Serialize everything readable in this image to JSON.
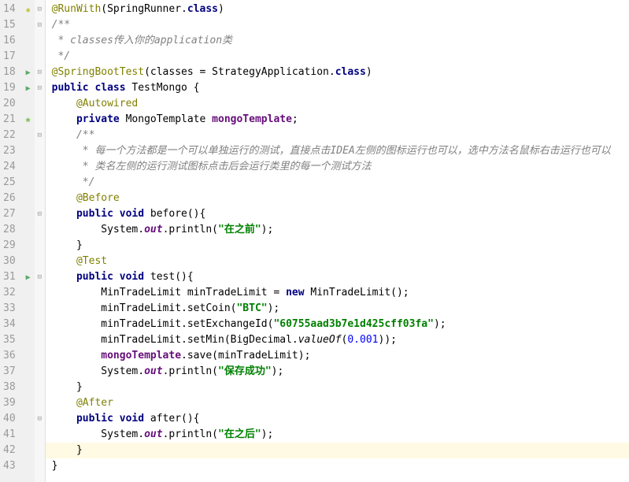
{
  "lines": [
    {
      "num": "14",
      "icon": "dot",
      "fold": "open",
      "ind": 0,
      "tokens": [
        {
          "t": "ann",
          "v": "@RunWith"
        },
        {
          "t": "",
          "v": "(SpringRunner."
        },
        {
          "t": "kw",
          "v": "class"
        },
        {
          "t": "",
          "v": ")"
        }
      ]
    },
    {
      "num": "15",
      "icon": "",
      "fold": "open",
      "ind": 0,
      "tokens": [
        {
          "t": "cmt",
          "v": "/**"
        }
      ],
      "bg": "cmt"
    },
    {
      "num": "16",
      "icon": "",
      "fold": "",
      "ind": 0,
      "tokens": [
        {
          "t": "cmt",
          "v": " * classes传入你的application类"
        }
      ]
    },
    {
      "num": "17",
      "icon": "",
      "fold": "",
      "ind": 0,
      "tokens": [
        {
          "t": "cmt",
          "v": " */"
        }
      ]
    },
    {
      "num": "18",
      "icon": "run",
      "fold": "open",
      "ind": 0,
      "tokens": [
        {
          "t": "ann",
          "v": "@SpringBootTest"
        },
        {
          "t": "",
          "v": "(classes = StrategyApplication."
        },
        {
          "t": "kw",
          "v": "class"
        },
        {
          "t": "",
          "v": ")"
        }
      ]
    },
    {
      "num": "19",
      "icon": "run",
      "fold": "open",
      "ind": 0,
      "tokens": [
        {
          "t": "kw",
          "v": "public class "
        },
        {
          "t": "cls",
          "v": "TestMongo {"
        }
      ]
    },
    {
      "num": "20",
      "icon": "",
      "fold": "",
      "ind": 1,
      "tokens": [
        {
          "t": "ann",
          "v": "@Autowired"
        }
      ]
    },
    {
      "num": "21",
      "icon": "spring",
      "fold": "",
      "ind": 1,
      "tokens": [
        {
          "t": "kw",
          "v": "private "
        },
        {
          "t": "",
          "v": "MongoTemplate "
        },
        {
          "t": "fld",
          "v": "mongoTemplate"
        },
        {
          "t": "",
          "v": ";"
        }
      ]
    },
    {
      "num": "22",
      "icon": "",
      "fold": "open",
      "ind": 1,
      "tokens": [
        {
          "t": "cmt",
          "v": "/**"
        }
      ]
    },
    {
      "num": "23",
      "icon": "",
      "fold": "",
      "ind": 1,
      "tokens": [
        {
          "t": "cmt",
          "v": " * 每一个方法都是一个可以单独运行的测试，直接点击IDEA左侧的图标运行也可以，选中方法名鼠标右击运行也可以"
        }
      ]
    },
    {
      "num": "24",
      "icon": "",
      "fold": "",
      "ind": 1,
      "tokens": [
        {
          "t": "cmt",
          "v": " * 类名左侧的运行测试图标点击后会运行类里的每一个测试方法"
        }
      ]
    },
    {
      "num": "25",
      "icon": "",
      "fold": "",
      "ind": 1,
      "tokens": [
        {
          "t": "cmt",
          "v": " */"
        }
      ]
    },
    {
      "num": "26",
      "icon": "",
      "fold": "",
      "ind": 1,
      "tokens": [
        {
          "t": "ann",
          "v": "@Before"
        }
      ]
    },
    {
      "num": "27",
      "icon": "",
      "fold": "open",
      "ind": 1,
      "tokens": [
        {
          "t": "kw",
          "v": "public void "
        },
        {
          "t": "",
          "v": "before(){"
        }
      ]
    },
    {
      "num": "28",
      "icon": "",
      "fold": "",
      "ind": 2,
      "tokens": [
        {
          "t": "",
          "v": "System."
        },
        {
          "t": "fld static",
          "v": "out"
        },
        {
          "t": "",
          "v": ".println("
        },
        {
          "t": "str",
          "v": "\"在之前\""
        },
        {
          "t": "",
          "v": ");"
        }
      ]
    },
    {
      "num": "29",
      "icon": "",
      "fold": "",
      "ind": 1,
      "tokens": [
        {
          "t": "",
          "v": "}"
        }
      ]
    },
    {
      "num": "30",
      "icon": "",
      "fold": "",
      "ind": 1,
      "tokens": [
        {
          "t": "ann",
          "v": "@Test"
        }
      ]
    },
    {
      "num": "31",
      "icon": "run",
      "fold": "open",
      "ind": 1,
      "tokens": [
        {
          "t": "kw",
          "v": "public void "
        },
        {
          "t": "",
          "v": "test(){"
        }
      ]
    },
    {
      "num": "32",
      "icon": "",
      "fold": "",
      "ind": 2,
      "tokens": [
        {
          "t": "",
          "v": "MinTradeLimit minTradeLimit = "
        },
        {
          "t": "kw",
          "v": "new "
        },
        {
          "t": "",
          "v": "MinTradeLimit();"
        }
      ]
    },
    {
      "num": "33",
      "icon": "",
      "fold": "",
      "ind": 2,
      "tokens": [
        {
          "t": "",
          "v": "minTradeLimit.setCoin("
        },
        {
          "t": "str",
          "v": "\"BTC\""
        },
        {
          "t": "",
          "v": ");"
        }
      ]
    },
    {
      "num": "34",
      "icon": "",
      "fold": "",
      "ind": 2,
      "tokens": [
        {
          "t": "",
          "v": "minTradeLimit.setExchangeId("
        },
        {
          "t": "str",
          "v": "\"60755aad3b7e1d425cff03fa\""
        },
        {
          "t": "",
          "v": ");"
        }
      ]
    },
    {
      "num": "35",
      "icon": "",
      "fold": "",
      "ind": 2,
      "tokens": [
        {
          "t": "",
          "v": "minTradeLimit.setMin(BigDecimal."
        },
        {
          "t": "static",
          "v": "valueOf"
        },
        {
          "t": "",
          "v": "("
        },
        {
          "t": "num",
          "v": "0.001"
        },
        {
          "t": "",
          "v": "));"
        }
      ]
    },
    {
      "num": "36",
      "icon": "",
      "fold": "",
      "ind": 2,
      "tokens": [
        {
          "t": "fld",
          "v": "mongoTemplate"
        },
        {
          "t": "",
          "v": ".save(minTradeLimit);"
        }
      ]
    },
    {
      "num": "37",
      "icon": "",
      "fold": "",
      "ind": 2,
      "tokens": [
        {
          "t": "",
          "v": "System."
        },
        {
          "t": "fld static",
          "v": "out"
        },
        {
          "t": "",
          "v": ".println("
        },
        {
          "t": "str",
          "v": "\"保存成功\""
        },
        {
          "t": "",
          "v": ");"
        }
      ]
    },
    {
      "num": "38",
      "icon": "",
      "fold": "",
      "ind": 1,
      "tokens": [
        {
          "t": "",
          "v": "}"
        }
      ]
    },
    {
      "num": "39",
      "icon": "",
      "fold": "",
      "ind": 1,
      "tokens": [
        {
          "t": "ann",
          "v": "@After"
        }
      ]
    },
    {
      "num": "40",
      "icon": "",
      "fold": "open",
      "ind": 1,
      "tokens": [
        {
          "t": "kw",
          "v": "public void "
        },
        {
          "t": "",
          "v": "after(){"
        }
      ]
    },
    {
      "num": "41",
      "icon": "",
      "fold": "",
      "ind": 2,
      "tokens": [
        {
          "t": "",
          "v": "System."
        },
        {
          "t": "fld static",
          "v": "out"
        },
        {
          "t": "",
          "v": ".println("
        },
        {
          "t": "str",
          "v": "\"在之后\""
        },
        {
          "t": "",
          "v": ");"
        }
      ]
    },
    {
      "num": "42",
      "icon": "",
      "fold": "",
      "ind": 1,
      "hl": true,
      "tokens": [
        {
          "t": "",
          "v": "}"
        }
      ]
    },
    {
      "num": "43",
      "icon": "",
      "fold": "",
      "ind": 0,
      "tokens": [
        {
          "t": "",
          "v": "}"
        }
      ]
    }
  ]
}
